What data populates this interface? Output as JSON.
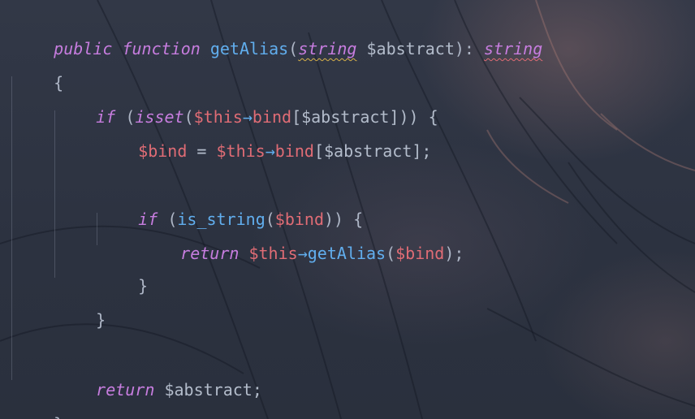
{
  "code": {
    "lines": [
      {
        "tokens": [
          "public",
          "function",
          "getAlias",
          "(",
          "string",
          "$abstract",
          "): ",
          "string"
        ]
      },
      {
        "tokens": [
          "{"
        ]
      },
      {
        "tokens": [
          "if",
          "(",
          "isset",
          "(",
          "$this",
          "→",
          "bind",
          "[$abstract])) {"
        ]
      },
      {
        "tokens": [
          "$bind",
          " = ",
          "$this",
          "→",
          "bind",
          "[$abstract];"
        ]
      },
      {
        "tokens": []
      },
      {
        "tokens": [
          "if",
          "(",
          "is_string",
          "(",
          "$bind",
          ")) {"
        ]
      },
      {
        "tokens": [
          "return",
          "$this",
          "→",
          "getAlias",
          "(",
          "$bind",
          ");"
        ]
      },
      {
        "tokens": [
          "}"
        ]
      },
      {
        "tokens": [
          "}"
        ]
      },
      {
        "tokens": []
      },
      {
        "tokens": [
          "return",
          "$abstract;"
        ]
      },
      {
        "tokens": [
          "}"
        ]
      }
    ]
  },
  "colors": {
    "keyword": "#c77ddf",
    "function": "#61aeee",
    "variable": "#e06c75",
    "plain": "#b3bccb",
    "warning_underline": "#d7b14a",
    "error_underline": "#e06c75",
    "background": "#2f3544"
  }
}
